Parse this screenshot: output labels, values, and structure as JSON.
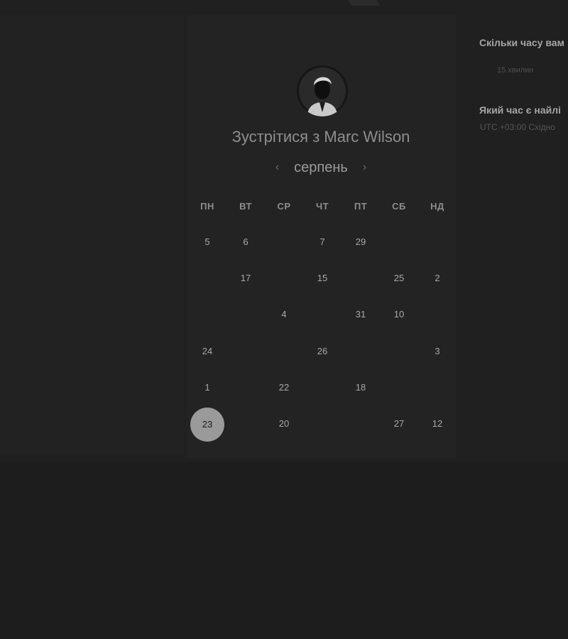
{
  "header": {
    "title_prefix": "Зустрітися з",
    "host_name": "Marc Wilson"
  },
  "calendar": {
    "month": "серпень",
    "prev_icon": "chevron-left-icon",
    "next_icon": "chevron-right-icon",
    "weekdays": [
      "ПН",
      "ВТ",
      "СР",
      "ЧТ",
      "ПТ",
      "СБ",
      "НД"
    ],
    "rows": [
      [
        {
          "label": "5",
          "available": true
        },
        {
          "label": "6",
          "available": true
        },
        {
          "label": "",
          "available": false
        },
        {
          "label": "7",
          "available": true
        },
        {
          "label": "29",
          "available": true
        },
        {
          "label": "",
          "available": false
        },
        {
          "label": "",
          "available": false
        }
      ],
      [
        {
          "label": "",
          "available": false
        },
        {
          "label": "17",
          "available": true
        },
        {
          "label": "",
          "available": false
        },
        {
          "label": "15",
          "available": true
        },
        {
          "label": "",
          "available": false
        },
        {
          "label": "25",
          "available": true
        },
        {
          "label": "2",
          "available": true
        }
      ],
      [
        {
          "label": "",
          "available": false
        },
        {
          "label": "",
          "available": false
        },
        {
          "label": "4",
          "available": true
        },
        {
          "label": "",
          "available": false
        },
        {
          "label": "31",
          "available": true
        },
        {
          "label": "10",
          "available": true
        },
        {
          "label": "",
          "available": false
        }
      ],
      [
        {
          "label": "24",
          "available": true
        },
        {
          "label": "",
          "available": false
        },
        {
          "label": "",
          "available": false
        },
        {
          "label": "26",
          "available": true
        },
        {
          "label": "",
          "available": false
        },
        {
          "label": "",
          "available": false
        },
        {
          "label": "3",
          "available": true
        }
      ],
      [
        {
          "label": "1",
          "available": true
        },
        {
          "label": "",
          "available": false
        },
        {
          "label": "22",
          "available": true
        },
        {
          "label": "",
          "available": false
        },
        {
          "label": "18",
          "available": true
        },
        {
          "label": "",
          "available": false
        },
        {
          "label": "",
          "available": false
        }
      ],
      [
        {
          "label": "23",
          "available": true,
          "selected": true
        },
        {
          "label": "",
          "available": false
        },
        {
          "label": "20",
          "available": true
        },
        {
          "label": "",
          "available": false
        },
        {
          "label": "",
          "available": false
        },
        {
          "label": "27",
          "available": true
        },
        {
          "label": "12",
          "available": true
        }
      ]
    ]
  },
  "sidebar": {
    "duration_question": "Скільки часу вам",
    "duration_value": "15 хвилин",
    "time_question": "Який час є найлі",
    "timezone": "UTC +03:00 Східно"
  },
  "colors": {
    "background": "#1d1d1d",
    "card": "#232323",
    "selected_day": "#9a9a9a"
  }
}
